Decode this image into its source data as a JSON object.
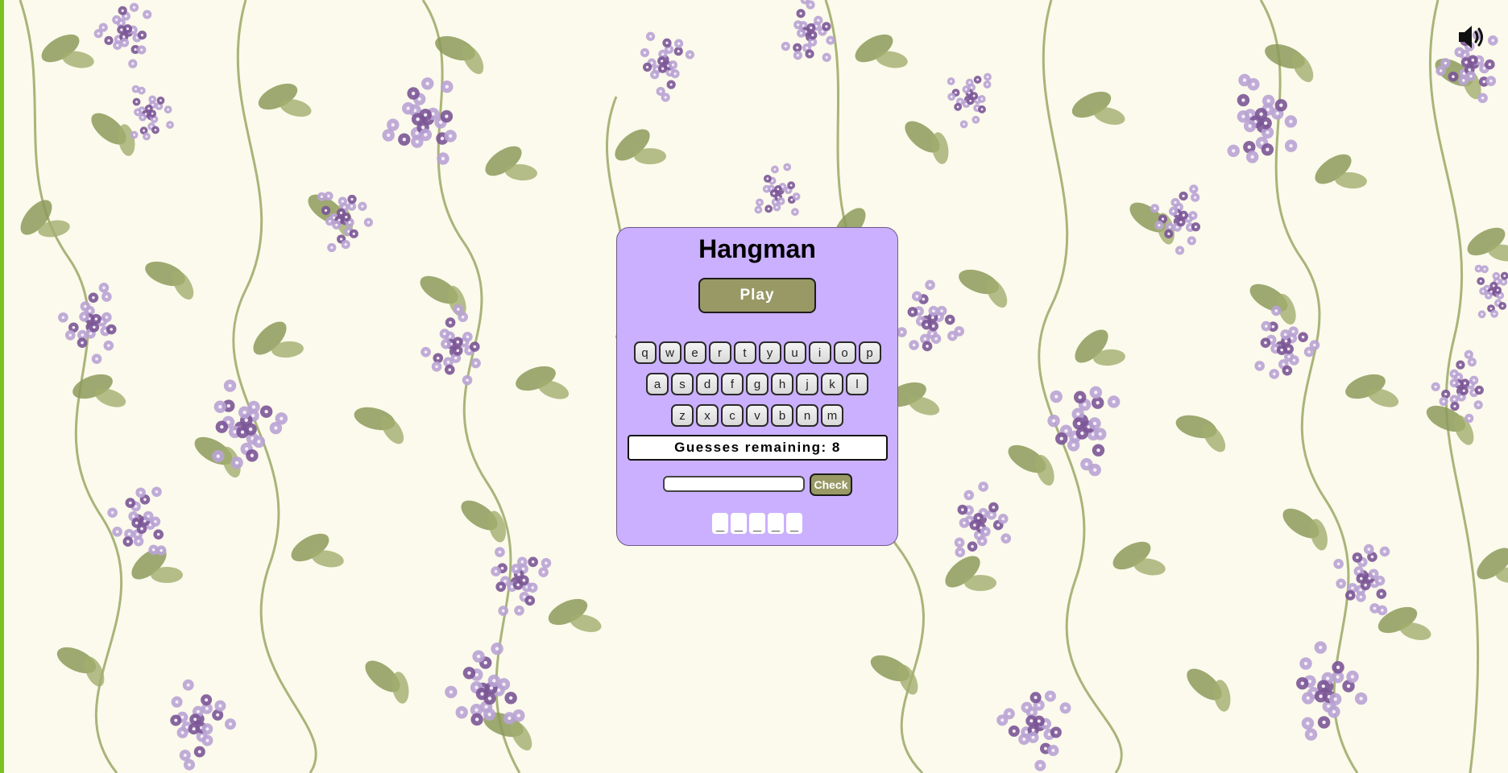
{
  "app": {
    "title": "Hangman",
    "play_label": "Play",
    "sound_icon": "speaker-volume-icon"
  },
  "keyboard": {
    "rows": [
      [
        "q",
        "w",
        "e",
        "r",
        "t",
        "y",
        "u",
        "i",
        "o",
        "p"
      ],
      [
        "a",
        "s",
        "d",
        "f",
        "g",
        "h",
        "j",
        "k",
        "l"
      ],
      [
        "z",
        "x",
        "c",
        "v",
        "b",
        "n",
        "m"
      ]
    ]
  },
  "status": {
    "guesses_text": "Guesses remaining: 8",
    "guesses_remaining": 8
  },
  "guess_form": {
    "input_value": "",
    "check_label": "Check"
  },
  "word": {
    "slots": [
      "_",
      "_",
      "_",
      "_",
      "_"
    ]
  },
  "colors": {
    "page_background": "#fbfaec",
    "panel": "#cbb0ff",
    "button": "#999966",
    "left_edge": "#7cc21e",
    "leaf": "#8c9a5b",
    "lilac_light": "#b9a3d4",
    "lilac_dark": "#7b5596"
  }
}
